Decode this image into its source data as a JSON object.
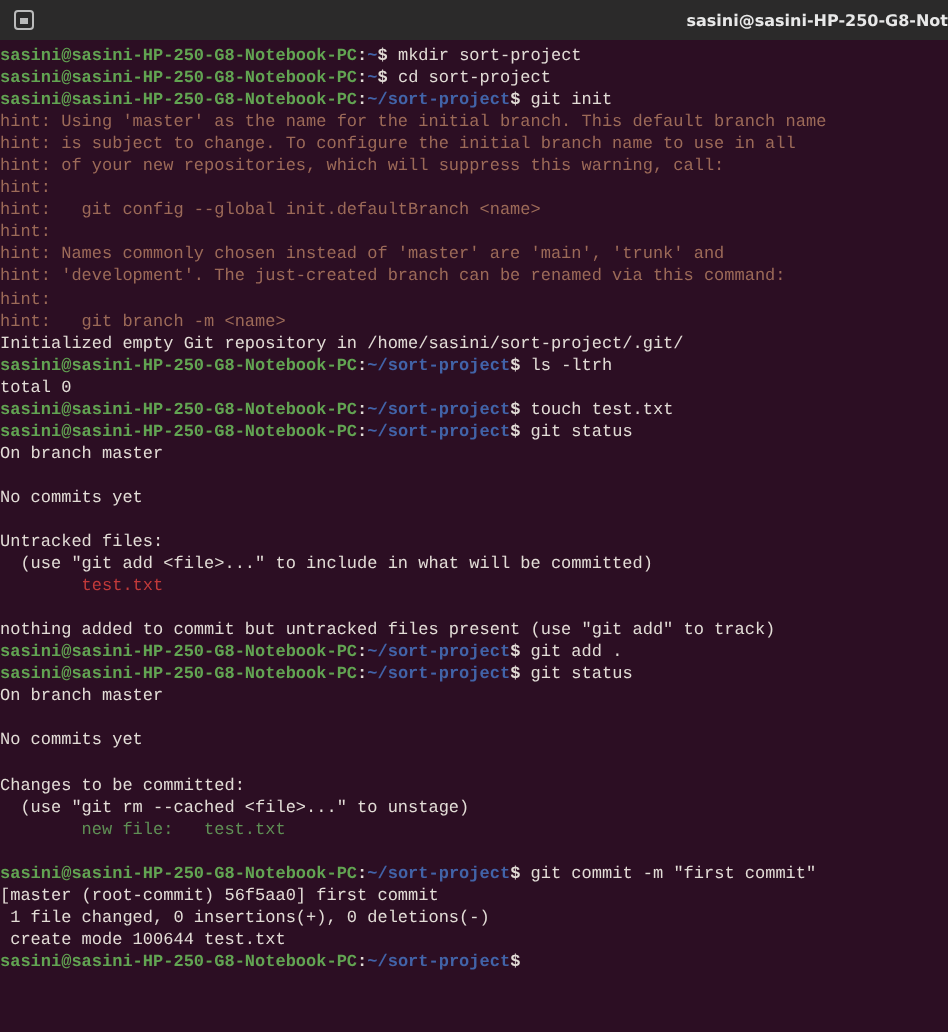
{
  "window": {
    "title": "sasini@sasini-HP-250-G8-Not"
  },
  "terminal": {
    "lines": [
      {
        "kind": "prompt",
        "user": "sasini@sasini-HP-250-G8-Notebook-PC",
        "separator": ":",
        "path": "~",
        "symbol": "$",
        "command": "mkdir sort-project"
      },
      {
        "kind": "prompt",
        "user": "sasini@sasini-HP-250-G8-Notebook-PC",
        "separator": ":",
        "path": "~",
        "symbol": "$",
        "command": "cd sort-project"
      },
      {
        "kind": "prompt",
        "user": "sasini@sasini-HP-250-G8-Notebook-PC",
        "separator": ":",
        "path": "~/sort-project",
        "symbol": "$",
        "command": "git init"
      },
      {
        "kind": "hint",
        "text": "hint: Using 'master' as the name for the initial branch. This default branch name"
      },
      {
        "kind": "hint",
        "text": "hint: is subject to change. To configure the initial branch name to use in all"
      },
      {
        "kind": "hint",
        "text": "hint: of your new repositories, which will suppress this warning, call:"
      },
      {
        "kind": "hint",
        "text": "hint:"
      },
      {
        "kind": "hint",
        "text": "hint:   git config --global init.defaultBranch <name>"
      },
      {
        "kind": "hint",
        "text": "hint:"
      },
      {
        "kind": "hint",
        "text": "hint: Names commonly chosen instead of 'master' are 'main', 'trunk' and"
      },
      {
        "kind": "hint",
        "text": "hint: 'development'. The just-created branch can be renamed via this command:"
      },
      {
        "kind": "hint",
        "text": "hint:"
      },
      {
        "kind": "hint",
        "text": "hint:   git branch -m <name>"
      },
      {
        "kind": "output",
        "text": "Initialized empty Git repository in /home/sasini/sort-project/.git/"
      },
      {
        "kind": "prompt",
        "user": "sasini@sasini-HP-250-G8-Notebook-PC",
        "separator": ":",
        "path": "~/sort-project",
        "symbol": "$",
        "command": "ls -ltrh"
      },
      {
        "kind": "output",
        "text": "total 0"
      },
      {
        "kind": "prompt",
        "user": "sasini@sasini-HP-250-G8-Notebook-PC",
        "separator": ":",
        "path": "~/sort-project",
        "symbol": "$",
        "command": "touch test.txt"
      },
      {
        "kind": "prompt",
        "user": "sasini@sasini-HP-250-G8-Notebook-PC",
        "separator": ":",
        "path": "~/sort-project",
        "symbol": "$",
        "command": "git status"
      },
      {
        "kind": "output",
        "text": "On branch master"
      },
      {
        "kind": "blank"
      },
      {
        "kind": "output",
        "text": "No commits yet"
      },
      {
        "kind": "blank"
      },
      {
        "kind": "output",
        "text": "Untracked files:"
      },
      {
        "kind": "output",
        "text": "  (use \"git add <file>...\" to include in what will be committed)"
      },
      {
        "kind": "untracked",
        "text": "test.txt"
      },
      {
        "kind": "blank"
      },
      {
        "kind": "output",
        "text": "nothing added to commit but untracked files present (use \"git add\" to track)"
      },
      {
        "kind": "prompt",
        "user": "sasini@sasini-HP-250-G8-Notebook-PC",
        "separator": ":",
        "path": "~/sort-project",
        "symbol": "$",
        "command": "git add ."
      },
      {
        "kind": "prompt",
        "user": "sasini@sasini-HP-250-G8-Notebook-PC",
        "separator": ":",
        "path": "~/sort-project",
        "symbol": "$",
        "command": "git status"
      },
      {
        "kind": "output",
        "text": "On branch master"
      },
      {
        "kind": "blank"
      },
      {
        "kind": "output",
        "text": "No commits yet"
      },
      {
        "kind": "blank"
      },
      {
        "kind": "output",
        "text": "Changes to be committed:"
      },
      {
        "kind": "output",
        "text": "  (use \"git rm --cached <file>...\" to unstage)"
      },
      {
        "kind": "staged",
        "text": "new file:   test.txt"
      },
      {
        "kind": "blank"
      },
      {
        "kind": "prompt",
        "user": "sasini@sasini-HP-250-G8-Notebook-PC",
        "separator": ":",
        "path": "~/sort-project",
        "symbol": "$",
        "command": "git commit -m \"first commit\""
      },
      {
        "kind": "output",
        "text": "[master (root-commit) 56f5aa0] first commit"
      },
      {
        "kind": "output",
        "text": " 1 file changed, 0 insertions(+), 0 deletions(-)"
      },
      {
        "kind": "output",
        "text": " create mode 100644 test.txt"
      },
      {
        "kind": "prompt",
        "user": "sasini@sasini-HP-250-G8-Notebook-PC",
        "separator": ":",
        "path": "~/sort-project",
        "symbol": "$"
      }
    ]
  }
}
